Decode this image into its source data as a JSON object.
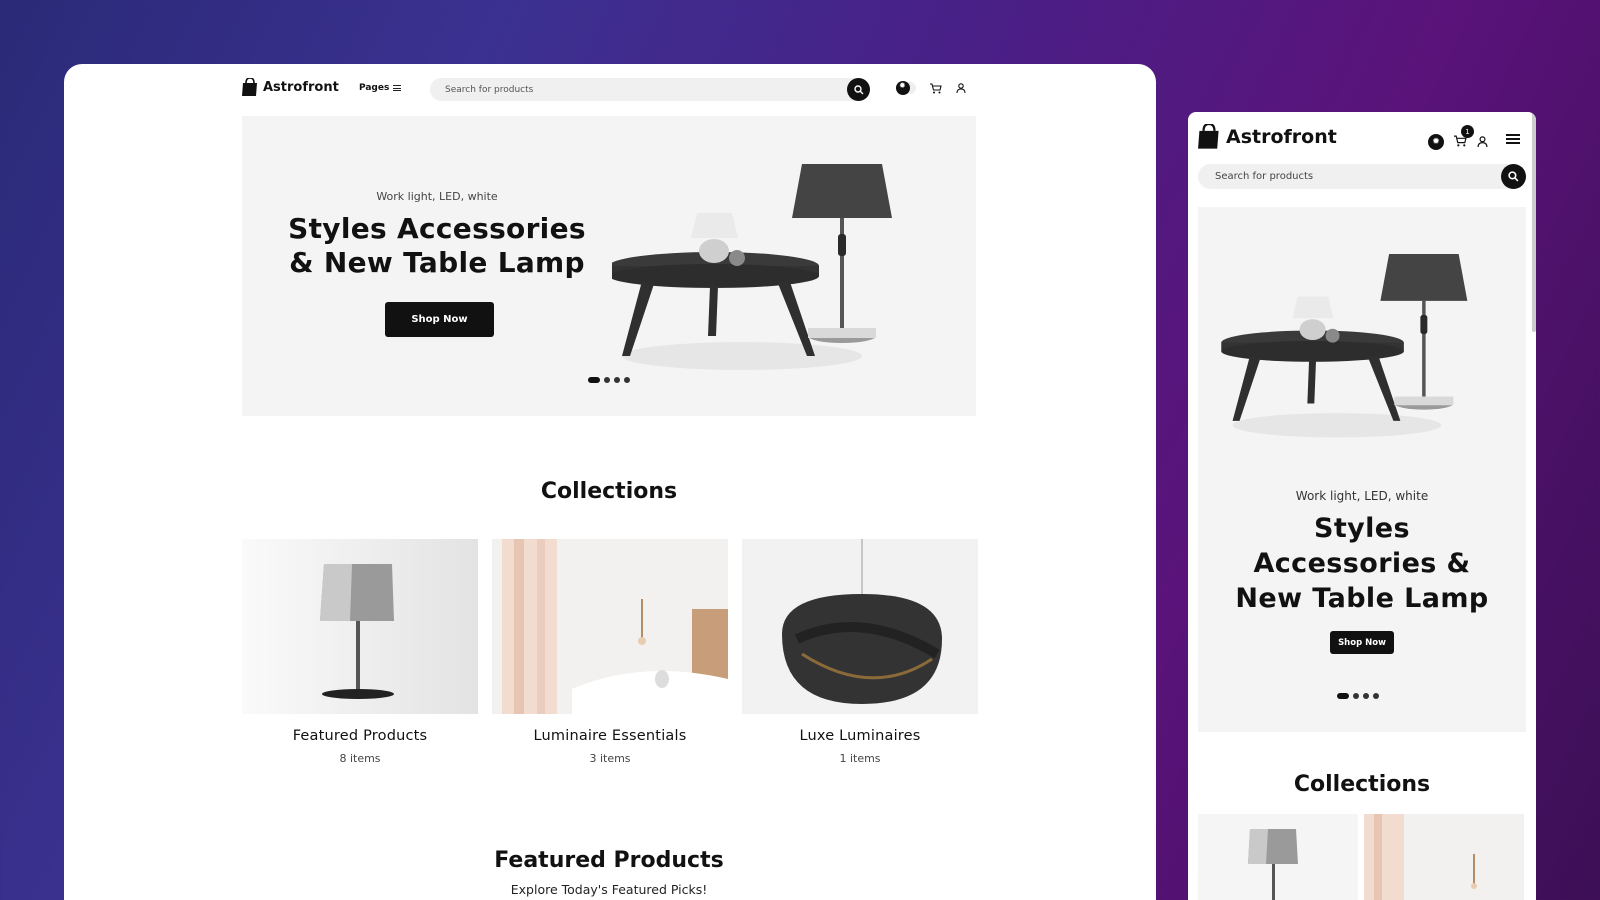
{
  "brand": {
    "name": "Astrofront"
  },
  "desktop": {
    "nav": {
      "pages_label": "Pages"
    },
    "search": {
      "placeholder": "Search for products"
    },
    "hero": {
      "subtitle": "Work light, LED, white",
      "title": "Styles Accessories & New Table Lamp",
      "cta": "Shop Now",
      "slides": 4,
      "active_slide": 1
    },
    "collections": {
      "title": "Collections",
      "items": [
        {
          "name": "Featured Products",
          "count": "8 items"
        },
        {
          "name": "Luminaire Essentials",
          "count": "3 items"
        },
        {
          "name": "Luxe Luminaires",
          "count": "1 items"
        }
      ]
    },
    "featured": {
      "title": "Featured Products",
      "subtitle": "Explore Today's Featured Picks!"
    }
  },
  "mobile": {
    "search": {
      "placeholder": "Search for products"
    },
    "cart_count": "1",
    "hero": {
      "subtitle": "Work light, LED, white",
      "title": "Styles Accessories & New Table Lamp",
      "cta": "Shop Now"
    },
    "collections": {
      "title": "Collections"
    }
  },
  "colors": {
    "accent": "#111111",
    "hero_bg": "#f4f4f4",
    "search_bg": "#f0f0f0"
  },
  "icons": [
    "bag-logo-icon",
    "menu-icon",
    "search-icon",
    "theme-toggle-icon",
    "cart-icon",
    "user-icon",
    "hamburger-icon"
  ]
}
